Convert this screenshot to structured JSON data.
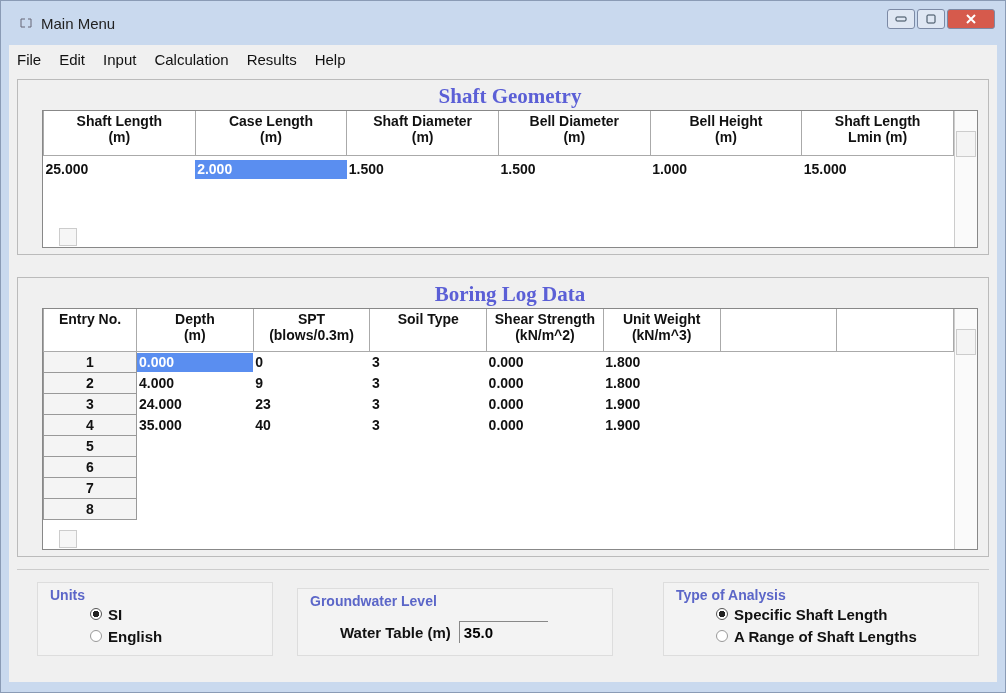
{
  "window": {
    "title": "Main Menu"
  },
  "menu": [
    "File",
    "Edit",
    "Input",
    "Calculation",
    "Results",
    "Help"
  ],
  "shaft_geometry": {
    "title": "Shaft Geometry",
    "columns": [
      {
        "label": "Shaft Length\n(m)"
      },
      {
        "label": "Case Length\n(m)"
      },
      {
        "label": "Shaft Diameter\n(m)"
      },
      {
        "label": "Bell Diameter\n(m)"
      },
      {
        "label": "Bell Height\n(m)"
      },
      {
        "label": "Shaft Length\nLmin (m)"
      }
    ],
    "rows": [
      [
        {
          "text": "25.000",
          "selected": false
        },
        {
          "text": "2.000",
          "selected": true
        },
        {
          "text": "1.500",
          "selected": false
        },
        {
          "text": "1.500",
          "selected": false
        },
        {
          "text": "1.000",
          "selected": false
        },
        {
          "text": "15.000",
          "selected": false
        }
      ]
    ]
  },
  "boring_log": {
    "title": "Boring Log Data",
    "corner": "Entry No.",
    "columns": [
      {
        "label": "Depth\n(m)"
      },
      {
        "label": "SPT\n(blows/0.3m)"
      },
      {
        "label": "Soil Type"
      },
      {
        "label": "Shear Strength\n(kN/m^2)"
      },
      {
        "label": "Unit Weight\n(kN/m^3)"
      },
      {},
      {}
    ],
    "rows": [
      {
        "entry": "1",
        "cells": [
          {
            "text": "0.000",
            "selected": true
          },
          {
            "text": "0",
            "selected": false
          },
          {
            "text": "3",
            "selected": false
          },
          {
            "text": "0.000",
            "selected": false
          },
          {
            "text": "1.800",
            "selected": false
          }
        ]
      },
      {
        "entry": "2",
        "cells": [
          {
            "text": "4.000",
            "selected": false
          },
          {
            "text": "9",
            "selected": false
          },
          {
            "text": "3",
            "selected": false
          },
          {
            "text": "0.000",
            "selected": false
          },
          {
            "text": "1.800",
            "selected": false
          }
        ]
      },
      {
        "entry": "3",
        "cells": [
          {
            "text": "24.000",
            "selected": false
          },
          {
            "text": "23",
            "selected": false
          },
          {
            "text": "3",
            "selected": false
          },
          {
            "text": "0.000",
            "selected": false
          },
          {
            "text": "1.900",
            "selected": false
          }
        ]
      },
      {
        "entry": "4",
        "cells": [
          {
            "text": "35.000",
            "selected": false
          },
          {
            "text": "40",
            "selected": false
          },
          {
            "text": "3",
            "selected": false
          },
          {
            "text": "0.000",
            "selected": false
          },
          {
            "text": "1.900",
            "selected": false
          }
        ]
      },
      {
        "entry": "5",
        "cells": []
      },
      {
        "entry": "6",
        "cells": []
      },
      {
        "entry": "7",
        "cells": []
      },
      {
        "entry": "8",
        "cells": []
      }
    ]
  },
  "units": {
    "title": "Units",
    "options": [
      {
        "label": "SI",
        "selected": true
      },
      {
        "label": "English",
        "selected": false
      }
    ]
  },
  "groundwater": {
    "title": "Groundwater Level",
    "label": "Water Table (m)",
    "value": "35.0"
  },
  "analysis": {
    "title": "Type of Analysis",
    "options": [
      {
        "label": "Specific Shaft Length",
        "selected": true
      },
      {
        "label": "A Range of Shaft Lengths",
        "selected": false
      }
    ]
  }
}
